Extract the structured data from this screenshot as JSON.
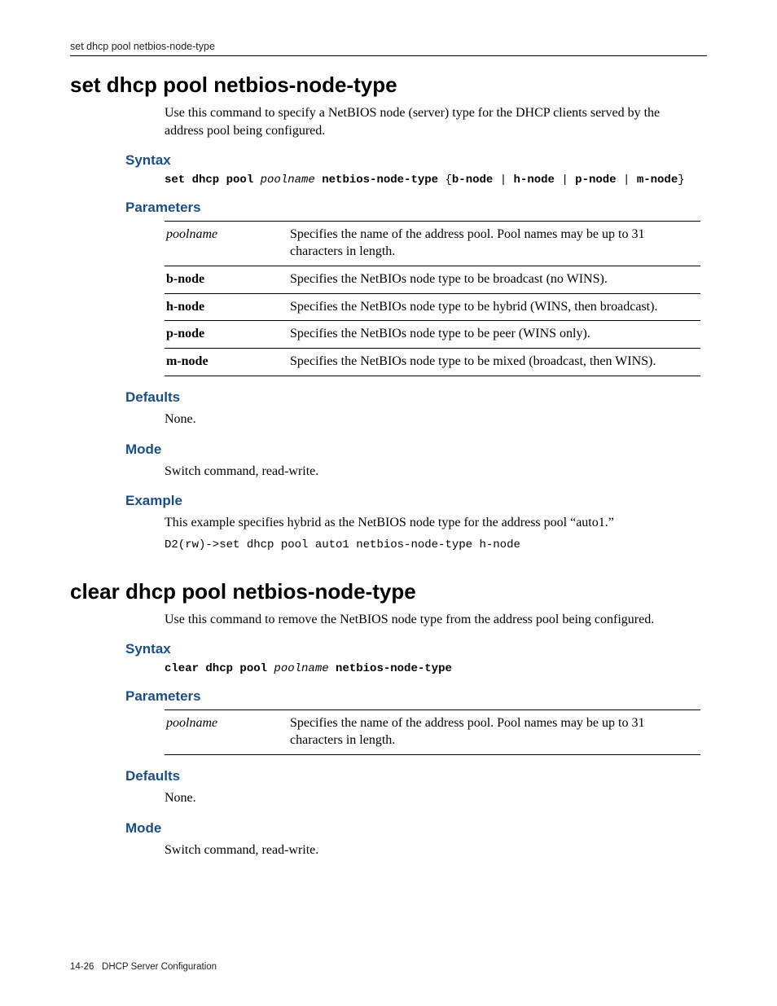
{
  "runningHead": "set dhcp pool netbios-node-type",
  "cmd1": {
    "title": "set dhcp pool netbios-node-type",
    "lead": "Use this command to specify a NetBIOS node (server) type for the DHCP clients served by the address pool being configured.",
    "syntaxLabel": "Syntax",
    "syntax": {
      "p1": "set dhcp pool ",
      "poolname": "poolname",
      "p2": " netbios-node-type ",
      "brace_open": "{",
      "opt1": "b-node",
      "pipe1": " | ",
      "opt2": "h-node",
      "pipe2": " | ",
      "opt3": "p-node",
      "pipe3": " | ",
      "opt4": "m-node",
      "brace_close": "}"
    },
    "paramsLabel": "Parameters",
    "params": [
      {
        "name": "poolname",
        "italic": true,
        "desc": "Specifies the name of the address pool. Pool names may be up to 31 characters in length."
      },
      {
        "name": "b-node",
        "bold": true,
        "desc": "Specifies the NetBIOs node type to be broadcast (no WINS)."
      },
      {
        "name": "h-node",
        "bold": true,
        "desc": "Specifies the NetBIOs node type to be hybrid (WINS, then broadcast)."
      },
      {
        "name": "p-node",
        "bold": true,
        "desc": "Specifies the NetBIOs node type to be peer (WINS only)."
      },
      {
        "name": "m-node",
        "bold": true,
        "desc": "Specifies the NetBIOs node type to be mixed (broadcast, then WINS)."
      }
    ],
    "defaultsLabel": "Defaults",
    "defaultsText": "None.",
    "modeLabel": "Mode",
    "modeText": "Switch command, read-write.",
    "exampleLabel": "Example",
    "exampleText": "This example specifies hybrid as the NetBIOS node type for the address pool “auto1.”",
    "exampleCode": "D2(rw)->set dhcp pool auto1 netbios-node-type h-node"
  },
  "cmd2": {
    "title": "clear dhcp pool netbios-node-type",
    "lead": "Use this command to remove the NetBIOS node type from the address pool being configured.",
    "syntaxLabel": "Syntax",
    "syntax": {
      "p1": "clear dhcp pool ",
      "poolname": "poolname",
      "p2": " netbios-node-type"
    },
    "paramsLabel": "Parameters",
    "params": [
      {
        "name": "poolname",
        "italic": true,
        "desc": "Specifies the name of the address pool. Pool names may be up to 31 characters in length."
      }
    ],
    "defaultsLabel": "Defaults",
    "defaultsText": "None.",
    "modeLabel": "Mode",
    "modeText": "Switch command, read-write."
  },
  "footer": {
    "pagenum": "14-26",
    "section": "DHCP Server Configuration"
  }
}
